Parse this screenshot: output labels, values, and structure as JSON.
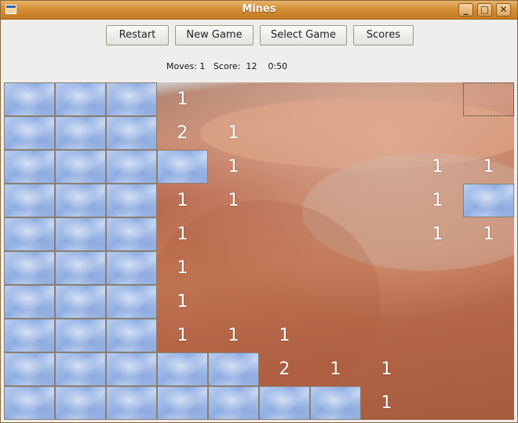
{
  "window": {
    "title": "Mines"
  },
  "toolbar": {
    "restart": "Restart",
    "new_game": "New Game",
    "select_game": "Select Game",
    "scores": "Scores"
  },
  "status": {
    "moves": "Moves: 1",
    "score": "Score:  12",
    "time": "0:50"
  },
  "board": {
    "cols": 10,
    "rows": 10,
    "cells": [
      [
        "C",
        "C",
        "C",
        "1",
        "",
        "",
        "",
        "",
        "",
        "F"
      ],
      [
        "C",
        "C",
        "C",
        "2",
        "1",
        "",
        "",
        "",
        "",
        ""
      ],
      [
        "C",
        "C",
        "C",
        "C",
        "1",
        "",
        "",
        "",
        "1",
        "1"
      ],
      [
        "C",
        "C",
        "C",
        "1",
        "1",
        "",
        "",
        "",
        "1",
        "C"
      ],
      [
        "C",
        "C",
        "C",
        "1",
        "",
        "",
        "",
        "",
        "1",
        "1"
      ],
      [
        "C",
        "C",
        "C",
        "1",
        "",
        "",
        "",
        "",
        "",
        ""
      ],
      [
        "C",
        "C",
        "C",
        "1",
        "",
        "",
        "",
        "",
        "",
        ""
      ],
      [
        "C",
        "C",
        "C",
        "1",
        "1",
        "1",
        "",
        "",
        "",
        ""
      ],
      [
        "C",
        "C",
        "C",
        "C",
        "C",
        "2",
        "1",
        "1",
        "",
        ""
      ],
      [
        "C",
        "C",
        "C",
        "C",
        "C",
        "C",
        "C",
        "1",
        "",
        ""
      ]
    ]
  }
}
